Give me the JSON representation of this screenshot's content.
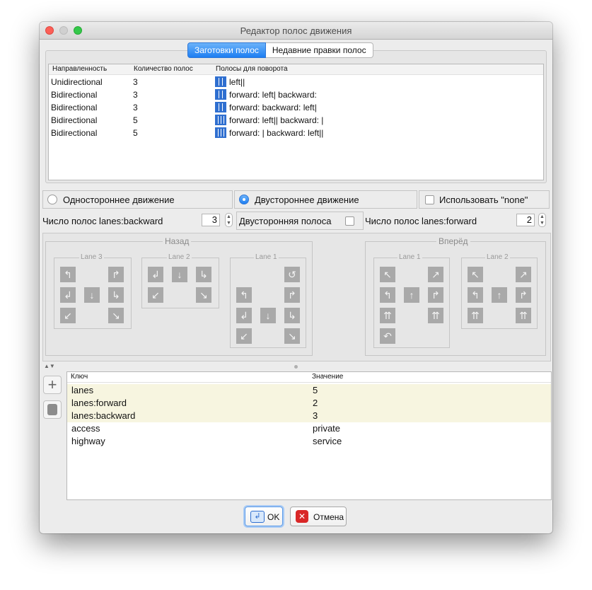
{
  "window": {
    "title": "Редактор полос движения"
  },
  "tabs": [
    {
      "label": "Заготовки полос",
      "active": true
    },
    {
      "label": "Недавние правки полос",
      "active": false
    }
  ],
  "presets": {
    "columns": [
      "Направленность",
      "Количество полос",
      "Полосы для поворота"
    ],
    "rows": [
      {
        "direction": "Unidirectional",
        "count": "3",
        "turns": "left||"
      },
      {
        "direction": "Bidirectional",
        "count": "3",
        "turns": "forward: left| backward:"
      },
      {
        "direction": "Bidirectional",
        "count": "3",
        "turns": "forward:  backward: left|"
      },
      {
        "direction": "Bidirectional",
        "count": "5",
        "turns": "forward: left|| backward: |"
      },
      {
        "direction": "Bidirectional",
        "count": "5",
        "turns": "forward: | backward: left||"
      }
    ]
  },
  "options": {
    "oneway": {
      "label": "Одностороннее движение",
      "selected": false
    },
    "twoway": {
      "label": "Двустороннее движение",
      "selected": true
    },
    "use_none": {
      "label": "Использовать \"none\"",
      "checked": false
    }
  },
  "counts": {
    "backward_label": "Число полос lanes:backward",
    "backward_value": "3",
    "both_label": "Двусторонняя полоса",
    "forward_label": "Число полос lanes:forward",
    "forward_value": "2"
  },
  "lanes": {
    "back_title": "Назад",
    "forward_title": "Вперёд",
    "back": [
      {
        "label": "Lane 3"
      },
      {
        "label": "Lane 2"
      },
      {
        "label": "Lane 1"
      }
    ],
    "forward": [
      {
        "label": "Lane 1"
      },
      {
        "label": "Lane 2"
      }
    ]
  },
  "tags": {
    "columns": [
      "Ключ",
      "Значение"
    ],
    "rows": [
      {
        "key": "lanes",
        "value": "5",
        "highlight": true
      },
      {
        "key": "lanes:forward",
        "value": "2",
        "highlight": true
      },
      {
        "key": "lanes:backward",
        "value": "3",
        "highlight": true
      },
      {
        "key": "access",
        "value": "private",
        "highlight": false
      },
      {
        "key": "highway",
        "value": "service",
        "highlight": false
      }
    ]
  },
  "buttons": {
    "ok": "OK",
    "cancel": "Отмена"
  },
  "colors": {
    "accent": "#1d7ef2",
    "highlight_row": "#f7f5e0",
    "lane_icon": "#2f6fd0"
  }
}
